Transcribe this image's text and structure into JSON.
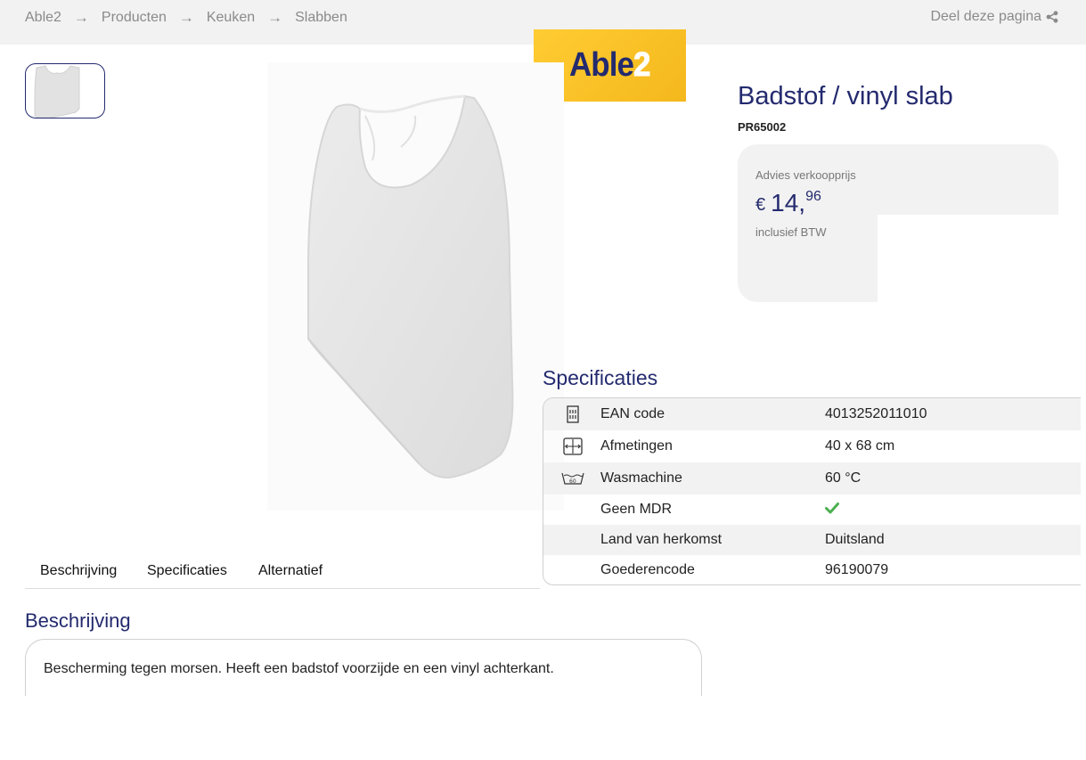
{
  "breadcrumb": {
    "items": [
      "Able2",
      "Producten",
      "Keuken",
      "Slabben"
    ],
    "separator": "→"
  },
  "share": {
    "label": "Deel deze pagina",
    "icon": "share-icon"
  },
  "logo": {
    "text_main": "Able",
    "text_accent": "2"
  },
  "product": {
    "title": "Badstof / vinyl slab",
    "sku": "PR65002"
  },
  "price": {
    "label": "Advies verkoopprijs",
    "currency": "€",
    "whole": "14,",
    "cents": "96",
    "note": "inclusief BTW"
  },
  "specs": {
    "title": "Specificaties",
    "rows": [
      {
        "icon": "barcode-icon",
        "label": "EAN code",
        "value": "4013252011010"
      },
      {
        "icon": "dimensions-icon",
        "label": "Afmetingen",
        "value": "40 x 68 cm"
      },
      {
        "icon": "washing-machine-60-icon",
        "label": "Wasmachine",
        "value": "60 °C"
      },
      {
        "icon": "",
        "label": "Geen MDR",
        "value": "",
        "value_icon": "checkmark-icon"
      },
      {
        "icon": "",
        "label": "Land van herkomst",
        "value": "Duitsland"
      },
      {
        "icon": "",
        "label": "Goederencode",
        "value": "96190079"
      }
    ]
  },
  "tabs": [
    "Beschrijving",
    "Specificaties",
    "Alternatief"
  ],
  "description": {
    "title": "Beschrijving",
    "text": "Bescherming tegen morsen. Heeft een badstof voorzijde en een vinyl achterkant."
  },
  "colors": {
    "brand_navy": "#232a6e",
    "brand_yellow": "#ffcc33",
    "check_green": "#4caf50"
  }
}
